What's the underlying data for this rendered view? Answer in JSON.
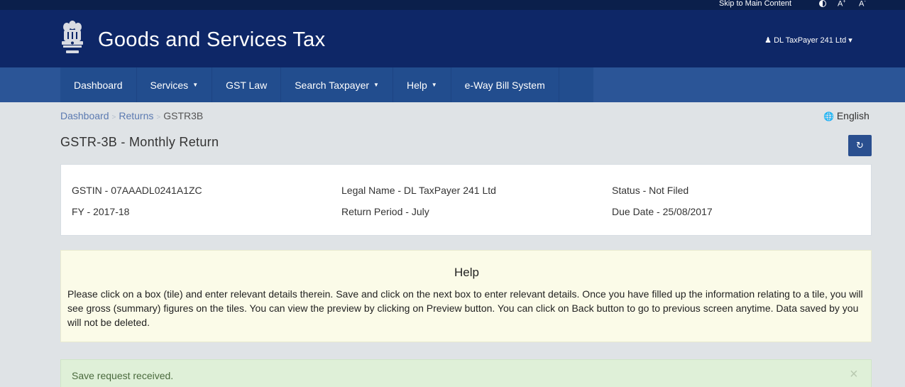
{
  "topbar": {
    "skip_link": "Skip to Main Content",
    "contrast_icon": "contrast-icon",
    "font_increase": "A+",
    "font_decrease": "A-"
  },
  "header": {
    "emblem_icon": "national-emblem-icon",
    "title": "Goods and Services Tax",
    "user_icon": "user-icon",
    "user_name": "DL TaxPayer 241 Ltd",
    "user_caret": "▾"
  },
  "nav": {
    "items": [
      {
        "label": "Dashboard",
        "has_dropdown": false
      },
      {
        "label": "Services",
        "has_dropdown": true
      },
      {
        "label": "GST Law",
        "has_dropdown": false
      },
      {
        "label": "Search Taxpayer",
        "has_dropdown": true
      },
      {
        "label": "Help",
        "has_dropdown": true
      },
      {
        "label": "e-Way Bill System",
        "has_dropdown": false
      }
    ],
    "caret": "▼"
  },
  "breadcrumb": {
    "items": [
      "Dashboard",
      "Returns",
      "GSTR3B"
    ]
  },
  "language": {
    "icon": "globe-icon",
    "label": "English"
  },
  "page": {
    "title": "GSTR-3B - Monthly Return",
    "refresh_icon": "refresh-icon"
  },
  "info": {
    "gstin": "GSTIN - 07AAADL0241A1ZC",
    "fy": "FY - 2017-18",
    "legal_name": "Legal Name - DL TaxPayer 241 Ltd",
    "return_period": "Return Period - July",
    "status": "Status - Not Filed",
    "due_date": "Due Date - 25/08/2017"
  },
  "help": {
    "title": "Help",
    "text": "Please click on a box (tile) and enter relevant details therein. Save and click on the next box to enter relevant details. Once you have filled up the information relating to a tile, you will see gross (summary) figures on the tiles. You can view the preview by clicking on Preview button. You can click on Back button to go to previous screen anytime. Data saved by you will not be deleted."
  },
  "alert": {
    "message": "Save request received.",
    "close_glyph": "×"
  },
  "colors": {
    "header_bg": "#0e2767",
    "nav_bg": "#224d8e",
    "help_bg": "#fbfbe8",
    "alert_bg": "#dff0d8"
  }
}
